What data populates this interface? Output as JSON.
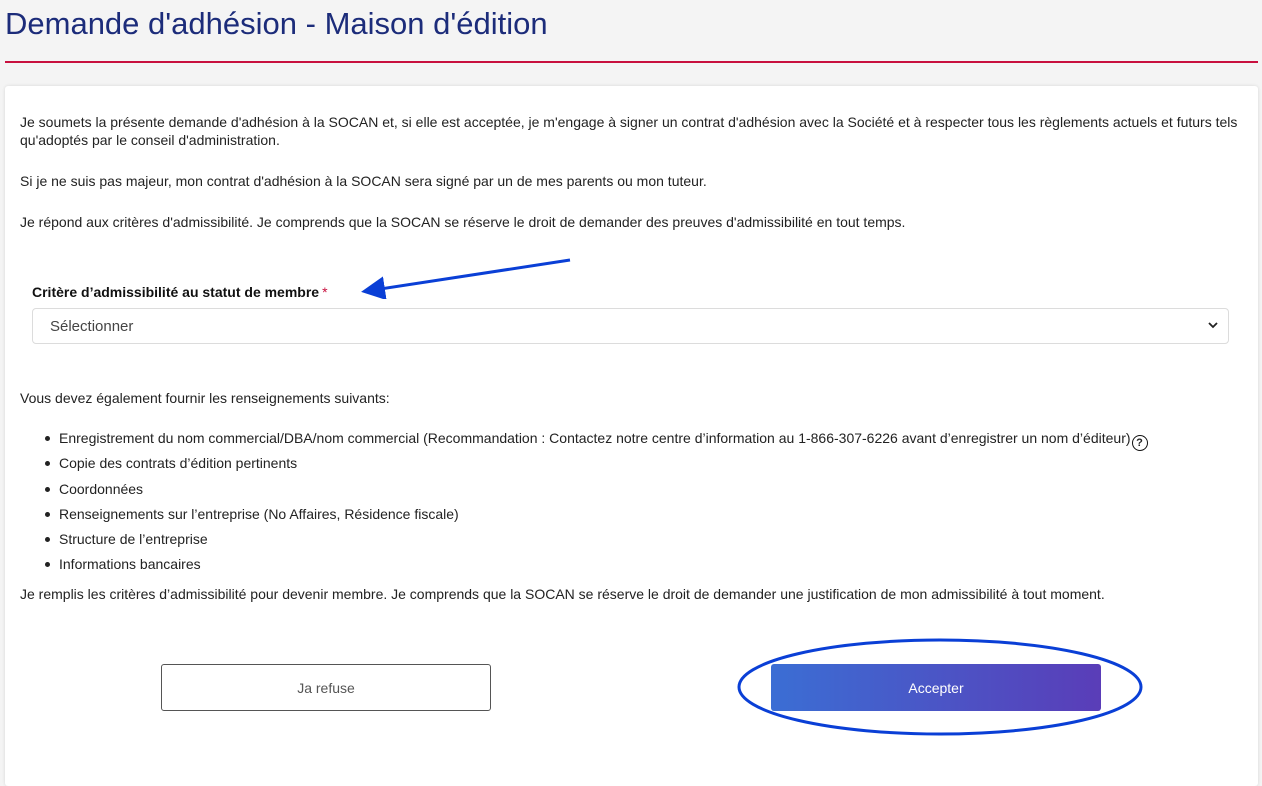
{
  "header": {
    "title": "Demande d'adhésion - Maison d'édition"
  },
  "intro": {
    "paragraph_1": "Je soumets la présente demande d'adhésion à la SOCAN et, si elle est acceptée, je m'engage à signer un contrat d'adhésion avec la Société et à respecter tous les règlements actuels et futurs tels qu'adoptés par le conseil d'administration.",
    "paragraph_2": "Si je ne suis pas majeur, mon contrat d'adhésion à la SOCAN sera signé par un de mes parents ou mon tuteur.",
    "paragraph_3": "Je répond aux critères d'admissibilité. Je comprends que la SOCAN se réserve le droit de demander des preuves d'admissibilité en tout temps."
  },
  "eligibility": {
    "label": "Critère d’admissibilité au statut de membre",
    "required_marker": "*",
    "selected_value": "Sélectionner"
  },
  "requirements": {
    "intro": "Vous devez également fournir les renseignements suivants:",
    "items": [
      "Enregistrement du nom commercial/DBA/nom commercial (Recommandation : Contactez notre centre d’information au 1-866-307-6226 avant d’enregistrer un nom d’éditeur)",
      "Copie des contrats d’édition pertinents",
      "Coordonnées",
      "Renseignements sur l’entreprise (No Affaires, Résidence fiscale)",
      "Structure de l’entreprise",
      "Informations bancaires"
    ],
    "help_glyph": "?",
    "closing": "Je remplis les critères d’admissibilité pour devenir membre. Je comprends que la SOCAN se réserve le droit de demander une justification de mon admissibilité à tout moment."
  },
  "actions": {
    "refuse_label": "Ja refuse",
    "accept_label": "Accepter"
  },
  "colors": {
    "title": "#1c2c7a",
    "accent_rule": "#c8103e",
    "annotation": "#0a3fd6",
    "accept_gradient_start": "#3b6ed4",
    "accept_gradient_end": "#5a3db8"
  },
  "icons": {
    "select_chevron": "chevron-down-icon",
    "help": "question-circle-icon"
  }
}
